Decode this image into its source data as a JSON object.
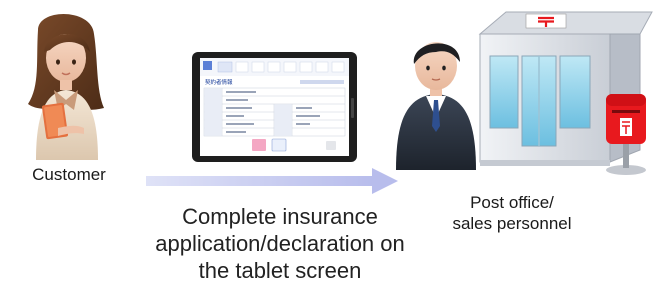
{
  "customer_label": "Customer",
  "post_office_label_line1": "Post office/",
  "post_office_label_line2": "sales personnel",
  "caption": "Complete insurance application/declaration on the tablet screen",
  "tablet": {
    "title": "契約者情報",
    "buttons": [
      "",
      ""
    ]
  },
  "colors": {
    "arrow": "#c9cdf0",
    "post_red": "#e8191e",
    "building_blue": "#8fd0e8",
    "suit": "#2b3340"
  }
}
